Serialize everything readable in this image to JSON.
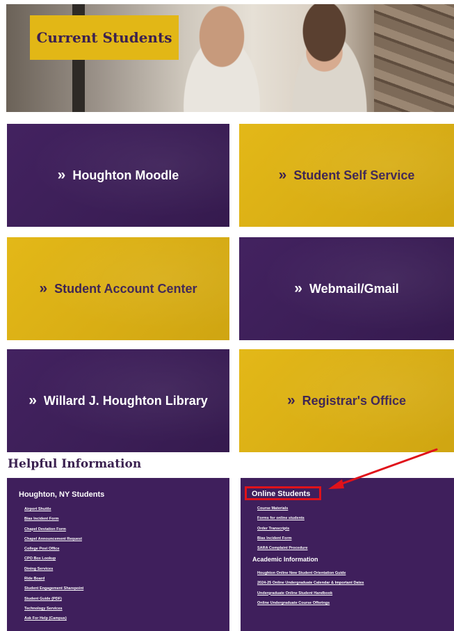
{
  "hero": {
    "title": "Current Students"
  },
  "tiles": [
    {
      "label": "Houghton Moodle",
      "chevron": "»",
      "color": "purple"
    },
    {
      "label": "Student Self Service",
      "chevron": "»",
      "color": "gold"
    },
    {
      "label": "Student Account Center",
      "chevron": "»",
      "color": "gold"
    },
    {
      "label": "Webmail/Gmail",
      "chevron": "»",
      "color": "purple"
    },
    {
      "label": "Willard J. Houghton Library",
      "chevron": "»",
      "color": "purple"
    },
    {
      "label": "Registrar's Office",
      "chevron": "»",
      "color": "gold"
    }
  ],
  "helpful": {
    "title": "Helpful Information",
    "left": {
      "title": "Houghton, NY Students",
      "links": [
        "Airport Shuttle",
        "Bias Incident Form",
        "Chapel Deviation Form",
        "Chapel Announcement Request",
        "College Post Office",
        "CPO Box Lookup",
        "Dining Services",
        "Ride Board",
        "Student Engagement Sharepoint",
        "Student Guide (PDF)",
        "Technology Services",
        "Ask For Help (Campus)"
      ]
    },
    "right": {
      "title": "Online Students",
      "links": [
        "Course Materials",
        "Forms for online students",
        "Order Transcripts",
        "Bias Incident Form",
        "SARA Complaint Procedure"
      ],
      "academic_title": "Academic Information",
      "academic_links": [
        "Houghton Online New Student Orientation Guide",
        "2024-25 Online Undergraduate Calendar & Important Dates",
        "Undergraduate Online Student Handbook",
        "Online Undergraduate Course Offerings"
      ]
    }
  },
  "colors": {
    "purple": "#3f1f5c",
    "gold": "#e2b716",
    "highlight": "#e0121a"
  },
  "icons": {
    "chevron": "double-chevron-right-icon",
    "arrow": "red-arrow-annotation-icon"
  }
}
